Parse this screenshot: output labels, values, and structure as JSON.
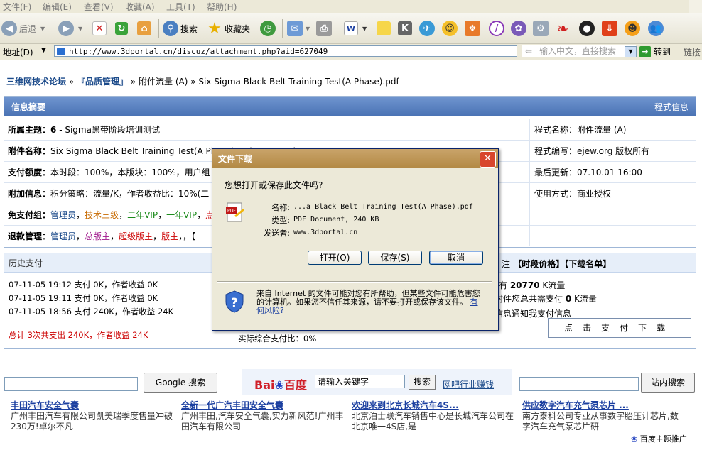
{
  "menubar": [
    "文件(F)",
    "编辑(E)",
    "查看(V)",
    "收藏(A)",
    "工具(T)",
    "帮助(H)"
  ],
  "toolbar": {
    "back": "后退",
    "search": "搜索",
    "favorites": "收藏夹"
  },
  "address": {
    "label": "地址(D)",
    "url": "http://www.3dportal.cn/discuz/attachment.php?aid=627049",
    "kw_placeholder": "输入中文，直接搜索",
    "go": "转到",
    "links": "链接"
  },
  "breadcrumb": {
    "site": "三维网技术论坛",
    "sep1": "»",
    "forum": "『品质管理』",
    "sep2": "»",
    "rest": "附件流量 (A) » Six Sigma Black Belt Training Test(A Phase).pdf"
  },
  "info": {
    "title": "信息摘要",
    "right_title": "程式信息",
    "rows": [
      {
        "label": "所属主题：",
        "value": "6",
        "value2": " - Sigma黑带阶段培训测试",
        "right": "程式名称：附件流量 (A)"
      },
      {
        "label": "附件名称：",
        "value": "Six Sigma Black Belt Training Test(A Phase) - K(248.13KB)",
        "right": "程式编写：ejew.org 版权所有"
      },
      {
        "label": "支付额度：",
        "value": "本时段：100%，本版块：100%，用户组",
        "right": "最后更新：07.10.01 16:00"
      },
      {
        "label": "附加信息：",
        "value": "积分策略：流量/K，作者收益比：10%(二",
        "right": "使用方式：商业授权"
      }
    ],
    "free_groups_label": "免支付组：",
    "free_groups": [
      {
        "t": "管理员",
        "c": "blue"
      },
      {
        "t": "技术三级",
        "c": "orange"
      },
      {
        "t": "二年VIP",
        "c": "green"
      },
      {
        "t": "一年VIP",
        "c": "green"
      },
      {
        "t": "点",
        "c": "red"
      }
    ],
    "refund_label": "退款管理：",
    "refund_groups": [
      {
        "t": "管理员",
        "c": "blue"
      },
      {
        "t": "总版主",
        "c": "purple"
      },
      {
        "t": "超级版主",
        "c": "red"
      },
      {
        "t": "版主",
        "c": "red"
      }
    ],
    "refund_tail": "，，【"
  },
  "history": {
    "title": "历史支付",
    "lines": [
      "07-11-05 19:12 支付 0K，作者收益 0K",
      "07-11-05 19:11 支付 0K，作者收益 0K",
      "07-11-05 18:56 支付 240K，作者收益 24K"
    ],
    "total": "总计 3次共支出 240K，作者收益 24K",
    "ratio": "实际综合支付比：0%",
    "right_head_prefix": "注",
    "right_head": "【时段价格】【下载名单】",
    "right1_pre": "有 ",
    "right1_num": "20770",
    "right1_post": " K流量",
    "right2_pre": "附件您总共需支付 ",
    "right2_num": "0",
    "right2_post": " K流量",
    "right3": "信息通知我支付信息",
    "download_btn": "点击支付下载"
  },
  "search": {
    "google_btn": "Google 搜索",
    "baidu_logo_a": "Bai",
    "baidu_logo_paw": "❀",
    "baidu_logo_b": "百度",
    "baidu_input": "请输入关键字",
    "baidu_btn": "搜索",
    "baidu_link": "网吧行业赚钱",
    "site_btn": "站内搜索"
  },
  "ads": [
    {
      "title": "丰田汽车安全气囊",
      "desc": "广州丰田汽车有限公司凯美瑞季度售量冲破230万!卓尔不凡"
    },
    {
      "title": "全新一代广汽丰田安全气囊",
      "desc": "广州丰田,汽车安全气囊,实力新风范!广州丰田汽车有限公司"
    },
    {
      "title": "欢迎来到北京长城汽车4S...",
      "desc": "北京泊士联汽车销售中心是长城汽车公司在北京唯一4S店,是"
    },
    {
      "title": "供应数字汽车充气泵芯片 ...",
      "desc": "南方泰科公司专业从事数字胎压计芯片,数字汽车充气泵芯片研"
    }
  ],
  "ad_footer": "百度主题推广",
  "dialog": {
    "title": "文件下载",
    "question": "您想打开或保存此文件吗?",
    "name_label": "名称:",
    "name": "...a Black Belt Training Test(A Phase).pdf",
    "type_label": "类型:",
    "type": "PDF Document, 240 KB",
    "from_label": "发送者:",
    "from": "www.3dportal.cn",
    "open": "打开(O)",
    "save": "保存(S)",
    "cancel": "取消",
    "warning": "来自 Internet 的文件可能对您有所帮助，但某些文件可能危害您的计算机。如果您不信任其来源，请不要打开或保存该文件。",
    "risk_link": "有何风险?"
  },
  "colors": {
    "panel_head": "#5a80c0",
    "dialog_title": "#b38a45",
    "link": "#1b4a8a"
  }
}
